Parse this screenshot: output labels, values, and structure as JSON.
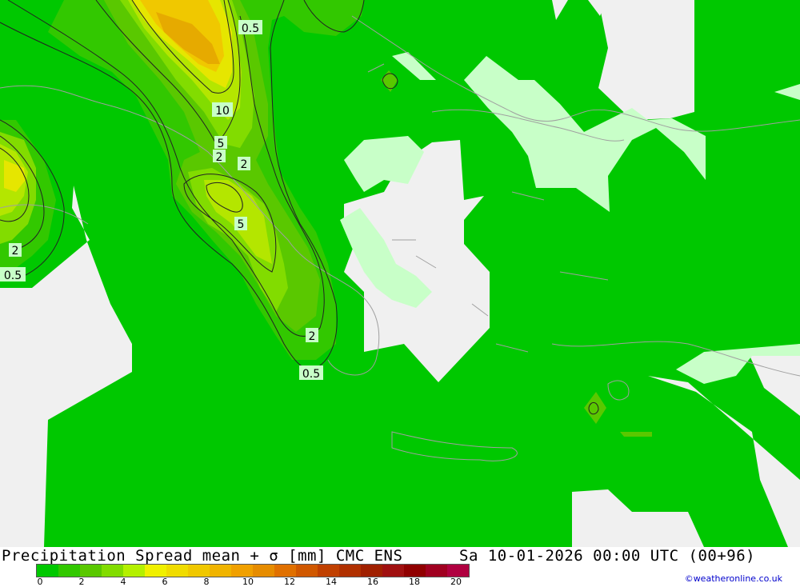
{
  "map": {
    "contour_labels": [
      {
        "text": "0.5"
      },
      {
        "text": "10"
      },
      {
        "text": "5"
      },
      {
        "text": "2"
      },
      {
        "text": "2"
      },
      {
        "text": "5"
      },
      {
        "text": "2"
      },
      {
        "text": "0.5"
      },
      {
        "text": "2"
      },
      {
        "text": "0.5"
      }
    ],
    "colors": {
      "base_green": "#00c800",
      "light_green": "#c8ffc8",
      "grey": "#f0f0f0",
      "mid_green": "#32c800",
      "lime": "#8cdc00",
      "yellow_green": "#b4e600",
      "yellow": "#e6e600",
      "orange_yellow": "#f0c800",
      "orange": "#e6aa00"
    }
  },
  "footer": {
    "title": "Precipitation Spread mean + σ [mm] CMC ENS",
    "datetime": "Sa 10-01-2026 00:00 UTC (00+96)",
    "credit": "©weatheronline.co.uk",
    "legend": {
      "colors": [
        "#00c800",
        "#32c800",
        "#5ac800",
        "#82dc00",
        "#b4f000",
        "#f0f000",
        "#f0dc00",
        "#f0c800",
        "#f0b400",
        "#f0a000",
        "#e68c00",
        "#e07000",
        "#d05800",
        "#c04000",
        "#b03000",
        "#a02000",
        "#a01010",
        "#900000",
        "#a00020",
        "#b00040"
      ],
      "ticks": [
        {
          "label": "0",
          "value": 0
        },
        {
          "label": "2",
          "value": 2
        },
        {
          "label": "4",
          "value": 4
        },
        {
          "label": "6",
          "value": 6
        },
        {
          "label": "8",
          "value": 8
        },
        {
          "label": "10",
          "value": 10
        },
        {
          "label": "12",
          "value": 12
        },
        {
          "label": "14",
          "value": 14
        },
        {
          "label": "16",
          "value": 16
        },
        {
          "label": "18",
          "value": 18
        },
        {
          "label": "20",
          "value": 20
        }
      ]
    }
  }
}
